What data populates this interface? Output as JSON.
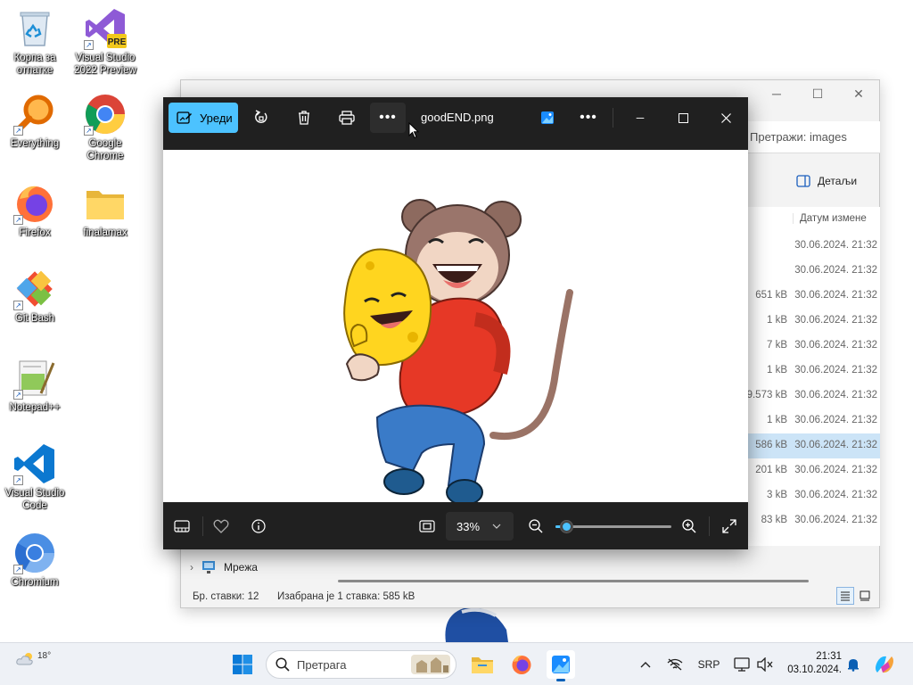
{
  "desktop": {
    "icons": [
      {
        "name": "recycle-bin",
        "label": "Корпа за отпатке"
      },
      {
        "name": "visual-studio-preview",
        "label": "Visual Studio 2022 Preview",
        "badge": "PRE"
      },
      {
        "name": "everything",
        "label": "Everything"
      },
      {
        "name": "google-chrome",
        "label": "Google Chrome"
      },
      {
        "name": "firefox",
        "label": "Firefox"
      },
      {
        "name": "finalamax",
        "label": "finalamax"
      },
      {
        "name": "git-bash",
        "label": "Git Bash"
      },
      {
        "name": "notepad-plus-plus",
        "label": "Notepad++"
      },
      {
        "name": "vs-code",
        "label": "Visual Studio Code"
      },
      {
        "name": "chromium",
        "label": "Chromium"
      }
    ]
  },
  "explorer": {
    "search_placeholder": "Претражи: images",
    "details_label": "Детаљи",
    "column_date": "Датум измене",
    "rows": [
      {
        "size": "",
        "date": "30.06.2024. 21:32"
      },
      {
        "size": "",
        "date": "30.06.2024. 21:32"
      },
      {
        "size": "651 kB",
        "date": "30.06.2024. 21:32"
      },
      {
        "size": "1 kB",
        "date": "30.06.2024. 21:32"
      },
      {
        "size": "7 kB",
        "date": "30.06.2024. 21:32"
      },
      {
        "size": "1 kB",
        "date": "30.06.2024. 21:32"
      },
      {
        "size": "9.573 kB",
        "date": "30.06.2024. 21:32"
      },
      {
        "size": "1 kB",
        "date": "30.06.2024. 21:32"
      },
      {
        "size": "586 kB",
        "date": "30.06.2024. 21:32",
        "selected": true
      },
      {
        "size": "201 kB",
        "date": "30.06.2024. 21:32"
      },
      {
        "size": "3 kB",
        "date": "30.06.2024. 21:32"
      },
      {
        "size": "83 kB",
        "date": "30.06.2024. 21:32"
      }
    ],
    "nav_network": "Мрежа",
    "status_count": "Бр. ставки: 12",
    "status_selected": "Изабрана је 1 ставка: 585 kB"
  },
  "viewer": {
    "edit_label": "Уреди",
    "filename": "goodEND.png",
    "zoom_value": "33%",
    "zoom_slider_fraction": 0.09
  },
  "taskbar": {
    "weather_temp": "18°",
    "search_placeholder": "Претрага",
    "language": "SRP",
    "time": "21:31",
    "date": "03.10.2024."
  },
  "colors": {
    "accent": "#4cc2ff",
    "viewer_bg": "#202020",
    "taskbar_bg": "#eef1f6",
    "selection": "#cce4f7"
  }
}
